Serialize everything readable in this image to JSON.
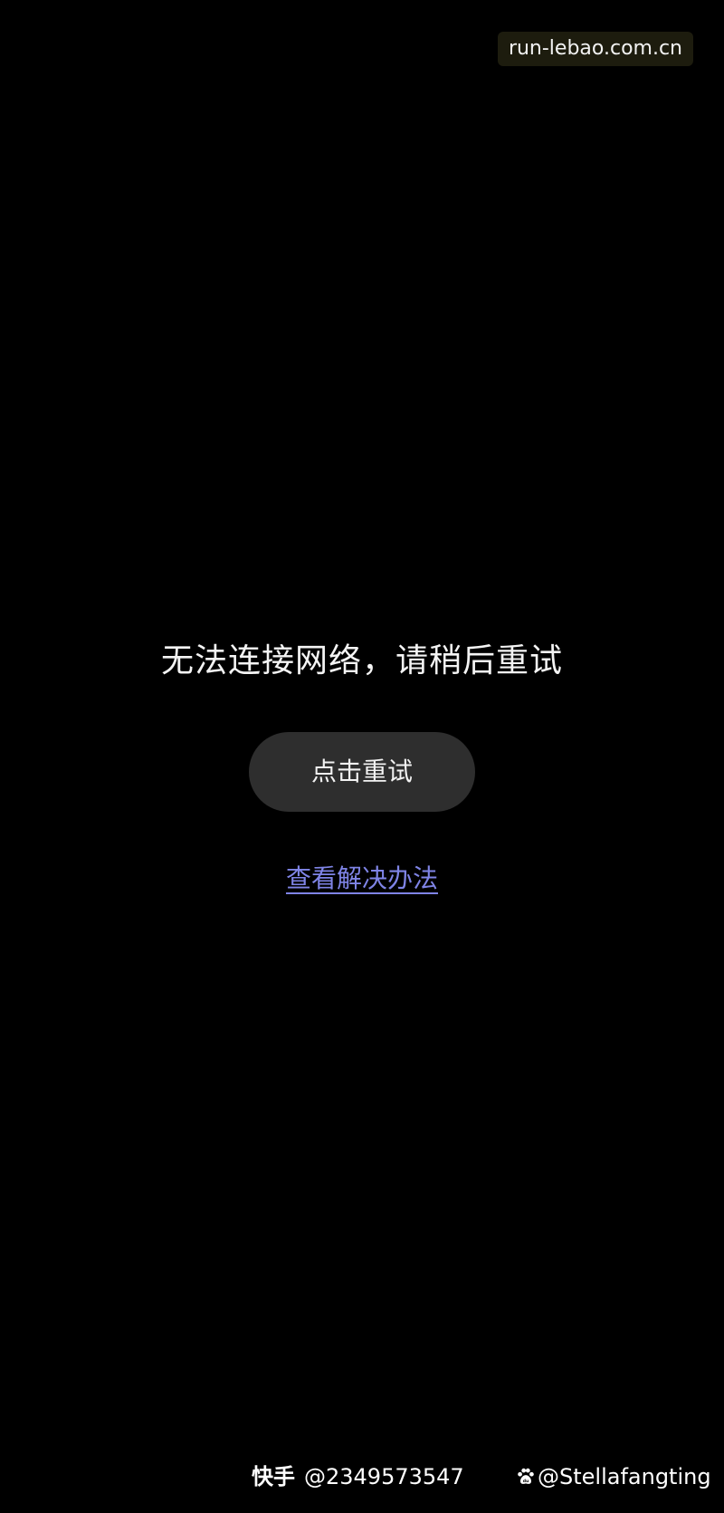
{
  "url_badge": "run-lebao.com.cn",
  "error": {
    "message": "无法连接网络，请稍后重试",
    "retry_label": "点击重试",
    "help_link": "查看解决办法"
  },
  "watermarks": {
    "kuaishou_brand": "快手",
    "kuaishou_id": "@2349573547",
    "baidu_icon": "paw-icon",
    "baidu_handle": "@Stellafangting"
  },
  "colors": {
    "background": "#000000",
    "button_bg": "#2e2e2e",
    "link": "#7f84e6"
  }
}
